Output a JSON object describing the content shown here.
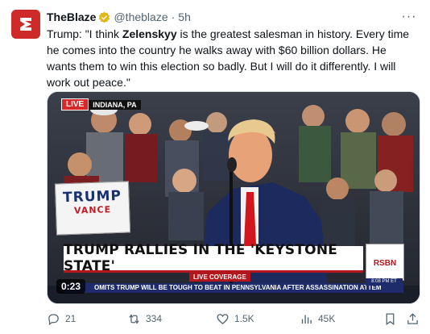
{
  "tweet": {
    "display_name": "TheBlaze",
    "handle": "@theblaze",
    "separator": "·",
    "time": "5h",
    "more_label": "···",
    "text_prefix": "Trump: \"I think ",
    "text_bold": "Zelenskyy",
    "text_suffix": " is the greatest salesman in history. Every time he comes into the country he walks away with $60 billion dollars. He wants them to win this election so badly. But I will do it differently. I will work out peace.\""
  },
  "media": {
    "live_label": "LIVE",
    "location": "INDIANA, PA",
    "sign_line1": "TRUMP",
    "sign_line2": "VANCE",
    "banner_text": "TRUMP RALLIES IN THE 'KEYSTONE STATE'",
    "coverage_label": "LIVE COVERAGE",
    "ticker_text": "OMITS TRUMP WILL BE TOUGH TO BEAT IN PENNSYLVANIA AFTER ASSASSINATION ATTEM",
    "network_logo": "RSBN",
    "network_time": "8:08 PM ET",
    "duration": "0:23"
  },
  "actions": {
    "replies": "21",
    "reposts": "334",
    "likes": "1.5K",
    "views": "45K"
  },
  "colors": {
    "brand_red": "#cf2a2a",
    "verified_gold": "#e2b719",
    "muted": "#536471"
  },
  "icons": [
    "blaze-logo-icon",
    "verified-badge-icon",
    "more-icon",
    "reply-icon",
    "repost-icon",
    "like-icon",
    "views-icon",
    "bookmark-icon",
    "share-icon"
  ]
}
